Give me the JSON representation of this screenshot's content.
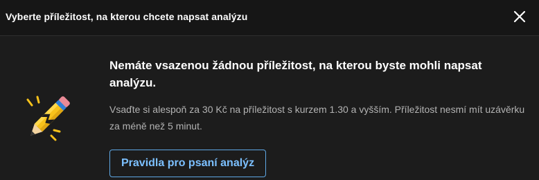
{
  "header": {
    "title": "Vyberte příležitost, na kterou chcete napsat analýzu",
    "close_icon": "close-icon"
  },
  "empty_state": {
    "illustration_icon": "pencil-icon",
    "heading": "Nemáte vsazenou žádnou příležitost, na kterou byste mohli napsat analýzu.",
    "description": "Vsaďte si alespoň za 30 Kč na příležitost s kurzem 1.30 a vyšším. Příležitost nesmí mít uzávěrku za méně než 5 minut.",
    "rules_button_label": "Pravidla pro psaní analýz"
  },
  "colors": {
    "background": "#1c1c1c",
    "header_background": "#161616",
    "accent": "#7cc0ff",
    "pencil_body": "#f7c21b",
    "pencil_eraser_band": "#2f7fd6"
  }
}
